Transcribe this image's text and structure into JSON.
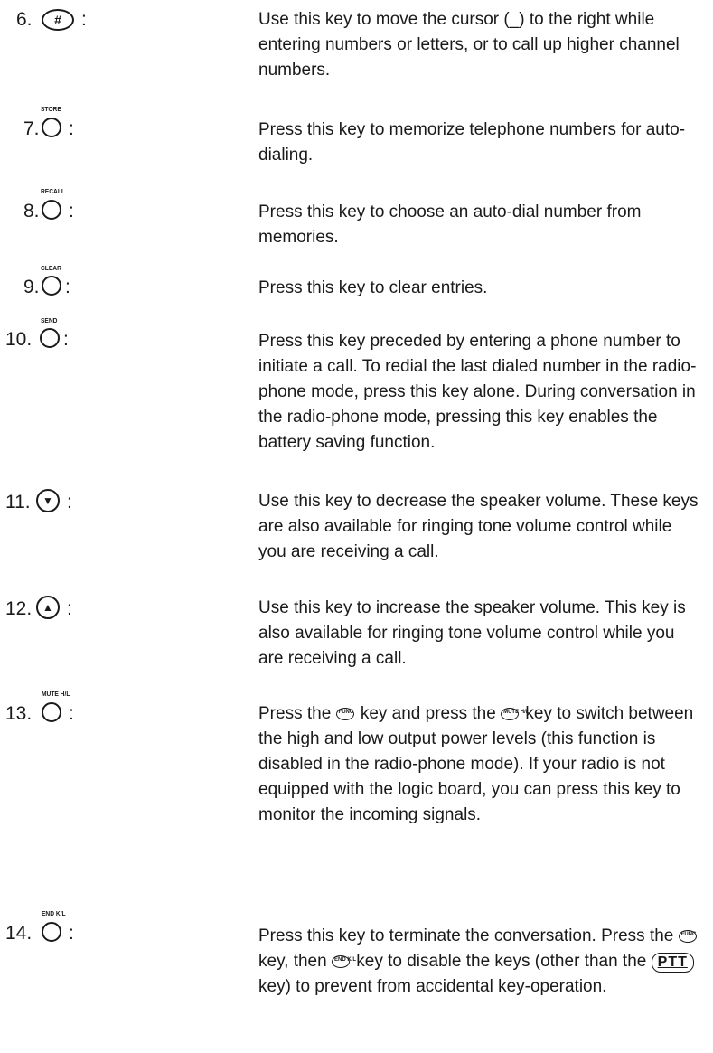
{
  "entries": [
    {
      "num": "6.",
      "key": "#",
      "key_style": "oval",
      "label": "",
      "colon": ":",
      "desc": "Use this key to move the cursor (_) to the right while entering numbers or letters, or to call up higher channel numbers."
    },
    {
      "num": "7.",
      "key": "",
      "key_style": "circle",
      "label": "STORE",
      "colon": ":",
      "desc": "Press this key to memorize telephone numbers for auto-dialing."
    },
    {
      "num": "8.",
      "key": "",
      "key_style": "circle",
      "label": "RECALL",
      "colon": ":",
      "desc": "Press this key to choose an auto-dial number from memories."
    },
    {
      "num": "9.",
      "key": "",
      "key_style": "circle",
      "label": "CLEAR",
      "colon": ":",
      "desc": "Press this key to clear entries."
    },
    {
      "num": "10.",
      "key": "",
      "key_style": "circle",
      "label": "SEND",
      "colon": ":",
      "desc": "Press this key preceded by entering a phone number to initiate a call. To redial the last dialed number in the radio-phone mode, press this key alone. During conversation in the radio-phone mode, pressing this key enables the battery saving function."
    },
    {
      "num": "11.",
      "key": "▼",
      "key_style": "round",
      "label": "",
      "colon": ":",
      "desc": "Use this key to decrease the speaker volume. These keys are also available for ringing tone volume control while you are receiving a call."
    },
    {
      "num": "12.",
      "key": "▲",
      "key_style": "round",
      "label": "",
      "colon": ":",
      "desc": "Use this key to increase the speaker volume. This key is also available for ringing tone volume control while you are receiving a call."
    },
    {
      "num": "13.",
      "key": "",
      "key_style": "circle",
      "label": "MUTE H/L",
      "colon": ":",
      "desc_parts": [
        "Press the",
        "key and press the",
        "key to switch between the high and low output power levels (this function is disabled in the radio-phone mode). If your radio is not equipped with the logic board, you can press this key to monitor the incoming signals."
      ],
      "inline_labels": [
        "FUNC",
        "MUTE H/L"
      ]
    },
    {
      "num": "14.",
      "key": "",
      "key_style": "circle",
      "label": "END K/L",
      "colon": ":",
      "desc_parts": [
        "Press this key to terminate the conversation. Press the",
        "key, then",
        "key to disable the keys (other than the",
        "key) to prevent from accidental key-operation."
      ],
      "inline_labels": [
        "FUNC",
        "END K/L",
        "PTT"
      ]
    }
  ]
}
